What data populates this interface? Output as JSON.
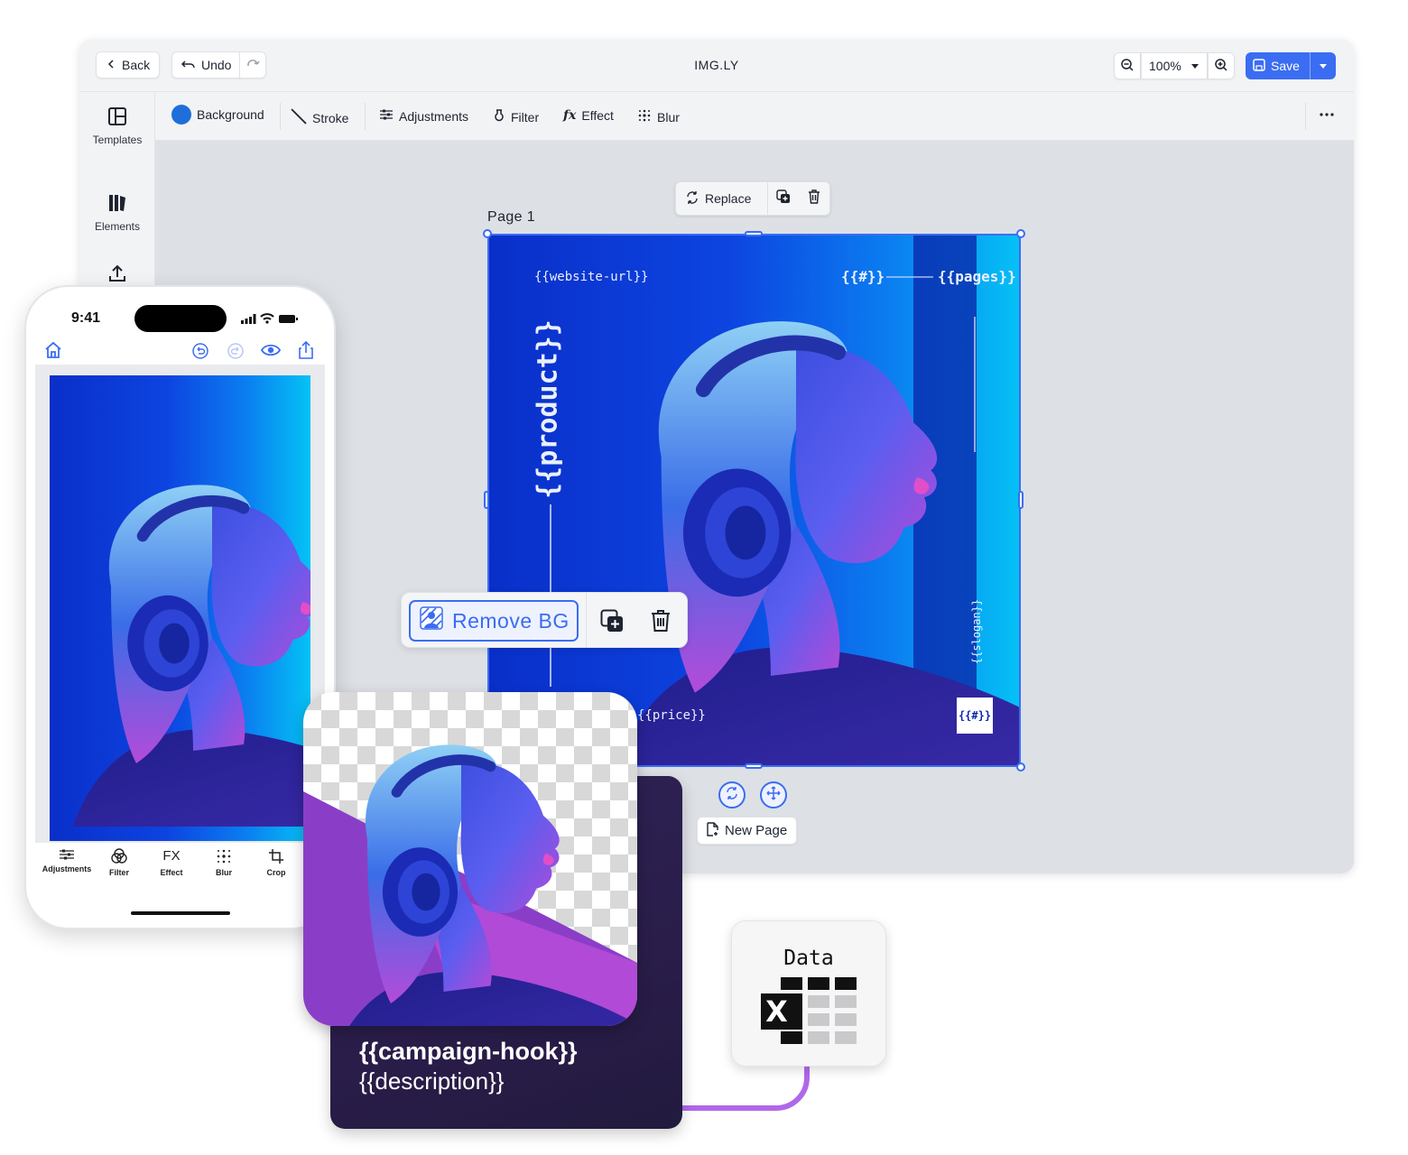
{
  "editor": {
    "title": "IMG.LY",
    "back_label": "Back",
    "undo_label": "Undo",
    "zoom_value": "100%",
    "save_label": "Save",
    "sidebar": [
      {
        "label": "Templates",
        "icon": "templates-icon"
      },
      {
        "label": "Elements",
        "icon": "elements-icon"
      },
      {
        "label": "",
        "icon": "upload-icon"
      }
    ],
    "toolbar": {
      "background_label": "Background",
      "background_color": "#1e6fd9",
      "stroke_label": "Stroke",
      "adjustments_label": "Adjustments",
      "filter_label": "Filter",
      "effect_label": "Effect",
      "blur_label": "Blur"
    },
    "replace_label": "Replace",
    "page_label": "Page 1",
    "new_page_label": "New Page",
    "accent_color": "#3b6df2"
  },
  "artboard": {
    "website_url": "{{website-url}}",
    "number": "{{#}}",
    "pages": "{{pages}}",
    "product": "{{product}}",
    "slogan": "{{slogan}}",
    "price": "{{price}}",
    "badge": "{{#}}"
  },
  "remove_bg": {
    "label": "Remove BG"
  },
  "phone": {
    "time": "9:41",
    "tools": [
      {
        "label": "Adjustments",
        "icon": "sliders-icon"
      },
      {
        "label": "Filter",
        "icon": "filter-icon"
      },
      {
        "label": "Effect",
        "icon": "fx-icon"
      },
      {
        "label": "Blur",
        "icon": "blur-icon"
      },
      {
        "label": "Crop",
        "icon": "crop-icon"
      }
    ],
    "fx_glyph": "FX"
  },
  "card": {
    "hook": "{{campaign-hook}}",
    "description": "{{description}}"
  },
  "data_tile": {
    "title": "Data",
    "glyph": "X"
  }
}
